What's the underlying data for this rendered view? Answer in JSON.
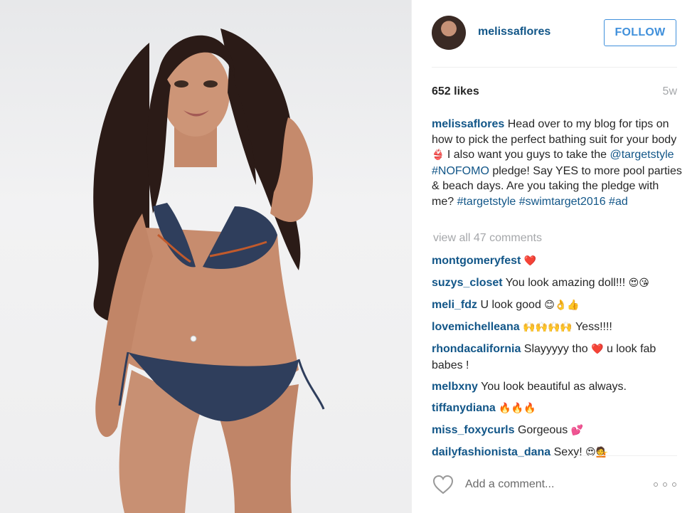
{
  "post": {
    "username": "melissaflores",
    "follow_label": "FOLLOW",
    "likes": "652 likes",
    "age": "5w",
    "caption": {
      "user": "melissaflores",
      "text_1": " Head over to my blog for tips on how to pick the perfect bathing suit for your body",
      "emoji_1": "👙",
      "text_2": " I also want you guys to take the ",
      "mention": "@targetstyle",
      "space_1": " ",
      "hashtag_1": "#NOFOMO",
      "text_3": " pledge! Say YES to more pool parties & beach days. Are you taking the pledge with me? ",
      "hashtag_2": "#targetstyle",
      "space_2": " ",
      "hashtag_3": "#swimtarget2016",
      "space_3": " ",
      "hashtag_4": "#ad"
    },
    "view_all": "view all 47 comments",
    "comments": [
      {
        "user": "montgomeryfest",
        "text": "",
        "emoji": "❤️"
      },
      {
        "user": "suzys_closet",
        "text": " You look amazing doll!!! ",
        "emoji": "😍😘"
      },
      {
        "user": "meli_fdz",
        "text": " U look good ",
        "emoji": "😊👌👍"
      },
      {
        "user": "lovemichelleana",
        "text": " ",
        "emoji": "🙌🙌🙌🙌",
        "text_after": " Yess!!!!"
      },
      {
        "user": "rhondacalifornia",
        "text": " Slayyyyy tho ",
        "emoji": "❤️",
        "text_after": " u look fab babes !"
      },
      {
        "user": "melbxny",
        "text": " You look beautiful as always.",
        "emoji": ""
      },
      {
        "user": "tiffanydiana",
        "text": " ",
        "emoji": "🔥🔥🔥"
      },
      {
        "user": "miss_foxycurls",
        "text": " Gorgeous ",
        "emoji": "💕"
      },
      {
        "user": "dailyfashionista_dana",
        "text": " Sexy! ",
        "emoji": "😍💁"
      }
    ],
    "add_comment_placeholder": "Add a comment...",
    "icons": {
      "like": "heart-outline-icon",
      "more": "more-options-icon"
    }
  },
  "colors": {
    "link": "#125688",
    "follow": "#4090db",
    "muted": "#a5a7aa",
    "text": "#262626"
  }
}
